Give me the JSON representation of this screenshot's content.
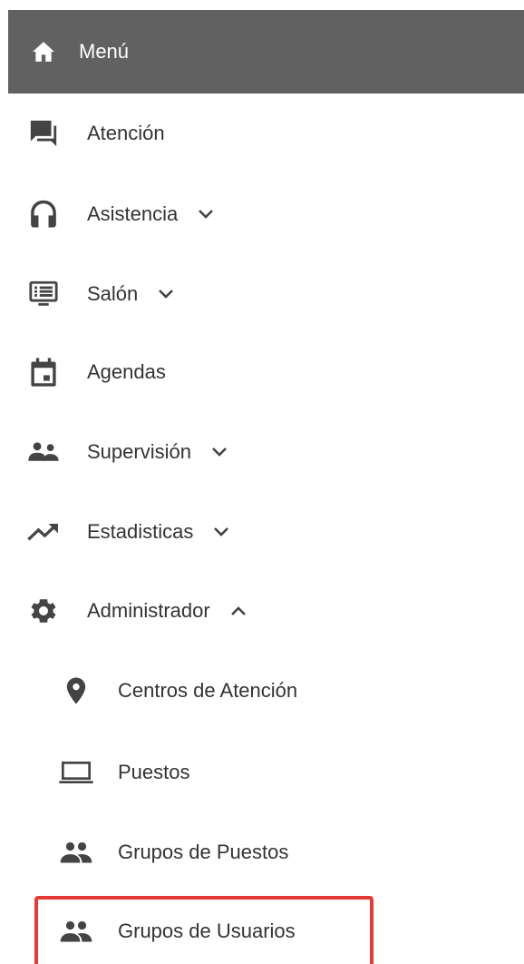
{
  "menu": {
    "title": "Menú"
  },
  "items": [
    {
      "label": "Atención",
      "icon": "forum-icon",
      "has_chevron": false
    },
    {
      "label": "Asistencia",
      "icon": "headset-icon",
      "has_chevron": true,
      "chevron": "down"
    },
    {
      "label": "Salón",
      "icon": "list-screen-icon",
      "has_chevron": true,
      "chevron": "down"
    },
    {
      "label": "Agendas",
      "icon": "calendar-icon",
      "has_chevron": false
    },
    {
      "label": "Supervisión",
      "icon": "supervisor-icon",
      "has_chevron": true,
      "chevron": "down"
    },
    {
      "label": "Estadisticas",
      "icon": "trending-up-icon",
      "has_chevron": true,
      "chevron": "down"
    },
    {
      "label": "Administrador",
      "icon": "gear-icon",
      "has_chevron": true,
      "chevron": "up"
    }
  ],
  "subitems": [
    {
      "label": "Centros de Atención",
      "icon": "location-pin-icon"
    },
    {
      "label": "Puestos",
      "icon": "laptop-icon"
    },
    {
      "label": "Grupos de Puestos",
      "icon": "people-icon"
    },
    {
      "label": "Grupos de Usuarios",
      "icon": "people-icon"
    }
  ],
  "colors": {
    "header_bg": "#616161",
    "header_text": "#ffffff",
    "text": "#333333",
    "icon": "#444444",
    "highlight_border": "#e53935"
  }
}
